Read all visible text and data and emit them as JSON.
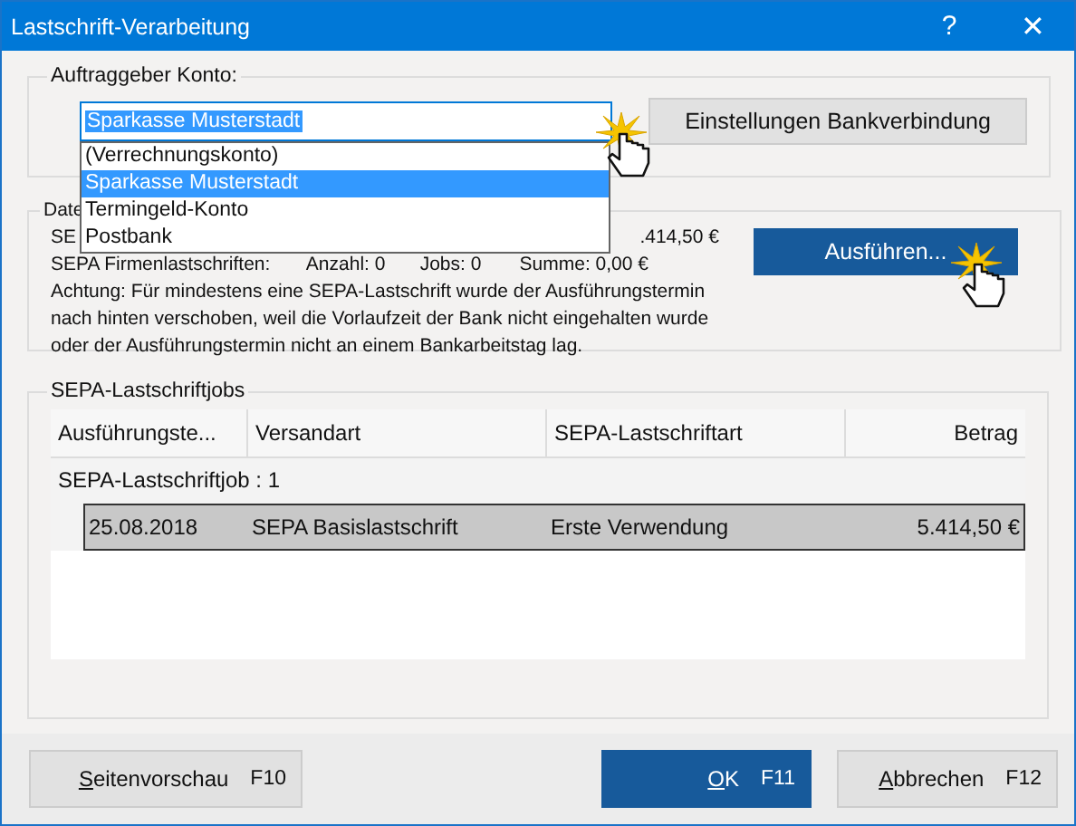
{
  "window": {
    "title": "Lastschrift-Verarbeitung",
    "help": "?",
    "close": "✕"
  },
  "account_group": {
    "legend": "Auftraggeber Konto:",
    "combo_value": "Sparkasse Musterstadt",
    "settings_button": "Einstellungen Bankverbindung",
    "dropdown": [
      {
        "label": "(Verrechnungskonto)",
        "selected": false
      },
      {
        "label": "Sparkasse Musterstadt",
        "selected": true
      },
      {
        "label": "Termingeld-Konto",
        "selected": false
      },
      {
        "label": "Postbank",
        "selected": false
      }
    ]
  },
  "data_group": {
    "legend": "Date",
    "line_1_start": "SE",
    "line_1_end": ".414,50 €",
    "line_2": {
      "label": "SEPA Firmenlastschriften:",
      "count": "Anzahl: 0",
      "jobs": "Jobs: 0",
      "sum": "Summe: 0,00 €"
    },
    "warning": "Achtung: Für mindestens eine SEPA-Lastschrift wurde der Ausführungstermin nach hinten verschoben, weil die Vorlaufzeit der Bank nicht eingehalten wurde oder der Ausführungstermin nicht an einem Bankarbeitstag lag.",
    "execute_button": "Ausführen..."
  },
  "jobs_group": {
    "legend": "SEPA-Lastschriftjobs",
    "table": {
      "columns": [
        "Ausführungste...",
        "Versandart",
        "SEPA-Lastschriftart",
        "Betrag"
      ],
      "group_row": "SEPA-Lastschriftjob : 1",
      "rows": [
        {
          "cells": [
            "25.08.2018",
            "SEPA Basislastschrift",
            "Erste Verwendung",
            "5.414,50 €"
          ],
          "selected": true
        }
      ]
    }
  },
  "footer": [
    {
      "label": "Seitenvorschau",
      "key": "F10",
      "primary": false,
      "mnemonic_underlined": true
    },
    {
      "label": "OK",
      "key": "F11",
      "primary": true,
      "mnemonic_underlined": true
    },
    {
      "label": "Abbrechen",
      "key": "F12",
      "primary": false,
      "mnemonic_underlined": true
    }
  ]
}
